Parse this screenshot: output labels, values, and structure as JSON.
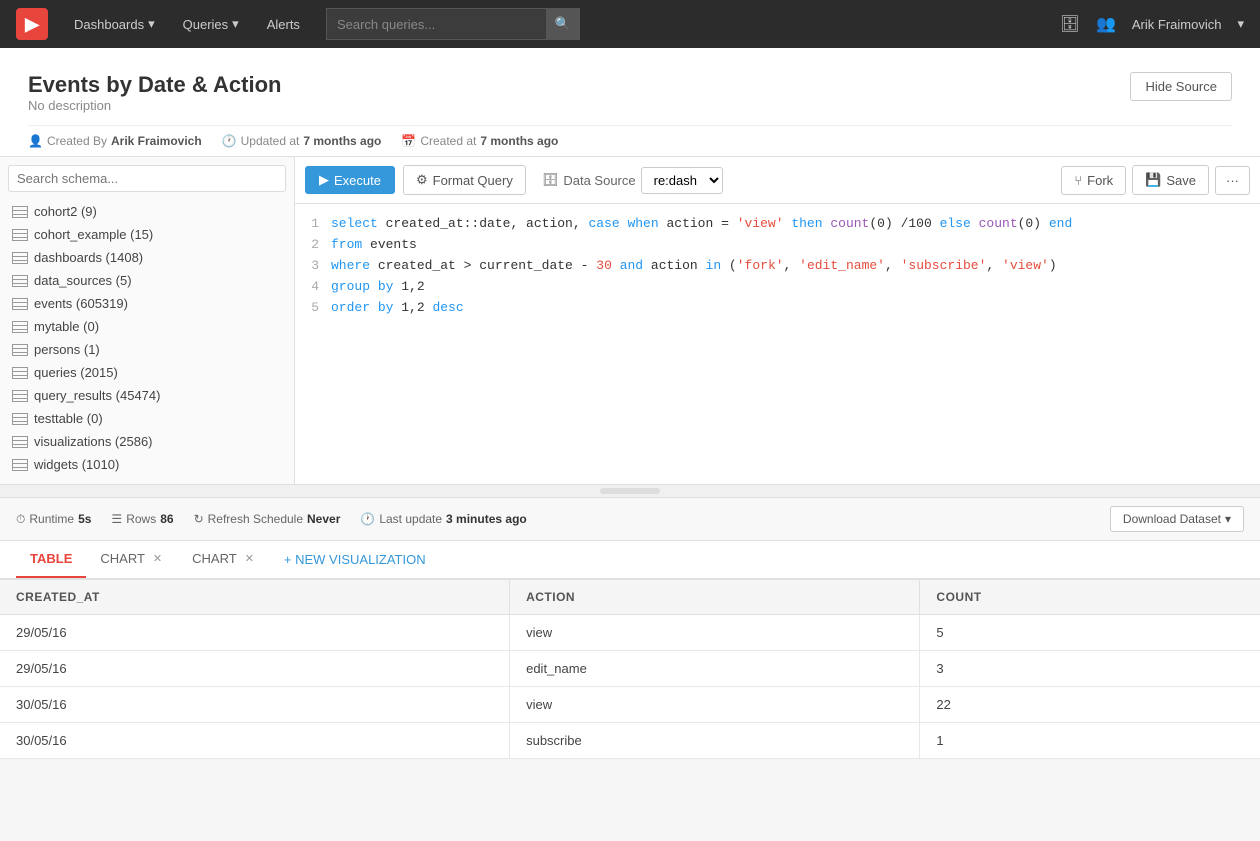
{
  "navbar": {
    "logo_symbol": "▶",
    "links": [
      {
        "label": "Dashboards",
        "has_arrow": true
      },
      {
        "label": "Queries",
        "has_arrow": true
      },
      {
        "label": "Alerts",
        "has_arrow": false
      }
    ],
    "search_placeholder": "Search queries...",
    "user": "Arik Fraimovich",
    "icons": [
      "database-icon",
      "users-icon"
    ]
  },
  "page": {
    "title": "Events by Date & Action",
    "description": "No description",
    "hide_source_label": "Hide Source",
    "meta": {
      "created_by_label": "Created By",
      "created_by": "Arik Fraimovich",
      "updated_label": "Updated at",
      "updated": "7 months ago",
      "created_label": "Created at",
      "created": "7 months ago"
    }
  },
  "schema": {
    "search_placeholder": "Search schema...",
    "tables": [
      {
        "name": "cohort2",
        "count": 9
      },
      {
        "name": "cohort_example",
        "count": 15
      },
      {
        "name": "dashboards",
        "count": 1408
      },
      {
        "name": "data_sources",
        "count": 5
      },
      {
        "name": "events",
        "count": 605319
      },
      {
        "name": "mytable",
        "count": 0
      },
      {
        "name": "persons",
        "count": 1
      },
      {
        "name": "queries",
        "count": 2015
      },
      {
        "name": "query_results",
        "count": 45474
      },
      {
        "name": "testtable",
        "count": 0
      },
      {
        "name": "visualizations",
        "count": 2586
      },
      {
        "name": "widgets",
        "count": 1010
      }
    ]
  },
  "toolbar": {
    "execute_label": "Execute",
    "format_label": "Format Query",
    "datasource_label": "Data Source",
    "datasource_value": "re:dash",
    "fork_label": "Fork",
    "save_label": "Save",
    "more_label": "···"
  },
  "code": {
    "lines": [
      {
        "num": 1,
        "html": "<span class='kw'>select</span> created_at::<span class='plain'>date, action, </span><span class='kw'>case when</span> action = <span class='str'>'view'</span> <span class='kw'>then</span> <span class='fn'>count</span>(0) /100 <span class='kw'>else</span> <span class='fn'>count</span>(0) <span class='kw'>end</span>"
      },
      {
        "num": 2,
        "html": "<span class='kw'>from</span> events"
      },
      {
        "num": 3,
        "html": "<span class='kw'>where</span> created_at > current_date - <span class='str'>30</span> <span class='kw'>and</span> action <span class='kw'>in</span> (<span class='str'>'fork'</span>, <span class='str'>'edit_name'</span>, <span class='str'>'subscribe'</span>, <span class='str'>'view'</span>)"
      },
      {
        "num": 4,
        "html": "<span class='kw'>group</span> <span class='kw'>by</span> 1,2"
      },
      {
        "num": 5,
        "html": "<span class='kw'>order</span> <span class='kw'>by</span> 1,2 <span class='kw'>desc</span>"
      }
    ]
  },
  "result_bar": {
    "runtime_label": "Runtime",
    "runtime_value": "5s",
    "rows_label": "Rows",
    "rows_value": "86",
    "refresh_label": "Refresh Schedule",
    "refresh_value": "Never",
    "last_update_label": "Last update",
    "last_update_value": "3 minutes ago",
    "download_label": "Download Dataset"
  },
  "tabs": [
    {
      "label": "TABLE",
      "active": true,
      "closeable": false
    },
    {
      "label": "CHART",
      "active": false,
      "closeable": true
    },
    {
      "label": "CHART",
      "active": false,
      "closeable": true
    }
  ],
  "new_viz_label": "+ NEW VISUALIZATION",
  "table": {
    "columns": [
      "CREATED_AT",
      "ACTION",
      "COUNT"
    ],
    "rows": [
      [
        "29/05/16",
        "view",
        "5"
      ],
      [
        "29/05/16",
        "edit_name",
        "3"
      ],
      [
        "30/05/16",
        "view",
        "22"
      ],
      [
        "30/05/16",
        "subscribe",
        "1"
      ]
    ]
  }
}
